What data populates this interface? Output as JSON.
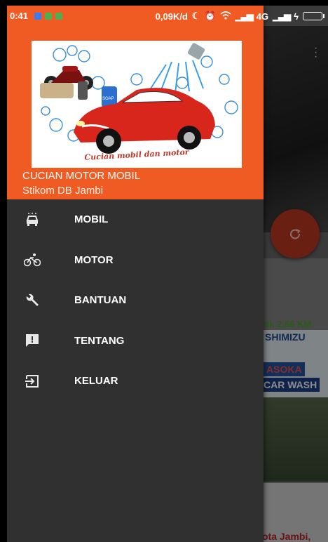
{
  "status_bar": {
    "time": "0:41",
    "speed": "0,09K/d",
    "network": "4G"
  },
  "drawer": {
    "title": "CUCIAN MOTOR MOBIL",
    "subtitle": "Stikom DB Jambi",
    "logo_caption": "Cucian mobil dan motor",
    "logo_soap_label": "SOAP",
    "items": [
      {
        "label": "MOBIL",
        "icon": "car-icon"
      },
      {
        "label": "MOTOR",
        "icon": "bicycle-icon"
      },
      {
        "label": "BANTUAN",
        "icon": "wrench-icon"
      },
      {
        "label": "TENTANG",
        "icon": "feedback-icon"
      },
      {
        "label": "KELUAR",
        "icon": "exit-icon"
      }
    ]
  },
  "background": {
    "distance": "rak 2.66 KM",
    "sign_line1": "SHIMIZU",
    "sign_line2": "ASOKA",
    "sign_line3": "CAR WASH",
    "city_text": "ota Jambi,"
  },
  "colors": {
    "header_orange": "#f05a23",
    "drawer_bg": "#303030",
    "fab_red": "#c0391f"
  }
}
